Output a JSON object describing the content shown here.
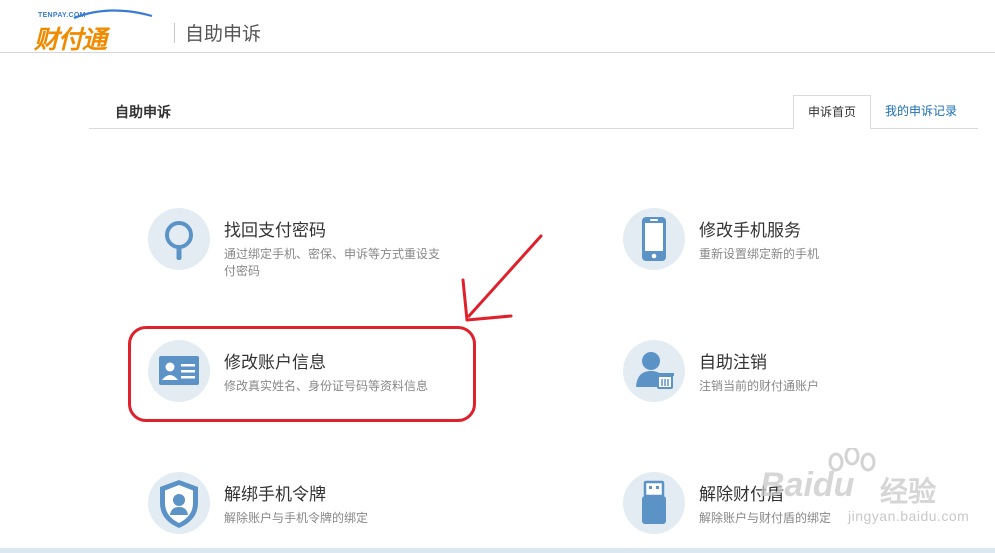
{
  "header": {
    "logo_small": "TENPAY.COM",
    "logo_text": "财付通",
    "title": "自助申诉"
  },
  "tabs": {
    "section_title": "自助申诉",
    "items": [
      {
        "label": "申诉首页",
        "active": true
      },
      {
        "label": "我的申诉记录",
        "active": false
      }
    ]
  },
  "services": [
    {
      "title": "找回支付密码",
      "desc": "通过绑定手机、密保、申诉等方式重设支付密码",
      "icon": "magnifier-icon"
    },
    {
      "title": "修改手机服务",
      "desc": "重新设置绑定新的手机",
      "icon": "mobile-phone-icon"
    },
    {
      "title": "修改账户信息",
      "desc": "修改真实姓名、身份证号码等资料信息",
      "icon": "id-card-icon"
    },
    {
      "title": "自助注销",
      "desc": "注销当前的财付通账户",
      "icon": "user-delete-icon"
    },
    {
      "title": "解绑手机令牌",
      "desc": "解除账户与手机令牌的绑定",
      "icon": "shield-user-icon"
    },
    {
      "title": "解除财付盾",
      "desc": "解除账户与财付盾的绑定",
      "icon": "usb-key-icon"
    }
  ],
  "watermark": {
    "brand": "Baidu",
    "product": "经验",
    "url": "jingyan.baidu.com"
  },
  "colors": {
    "brand_orange": "#f08b00",
    "link_blue": "#1a6fb3",
    "icon_blue": "#5b93c7",
    "icon_bg": "#e3ecf3",
    "annotation_red": "#e0202b"
  }
}
